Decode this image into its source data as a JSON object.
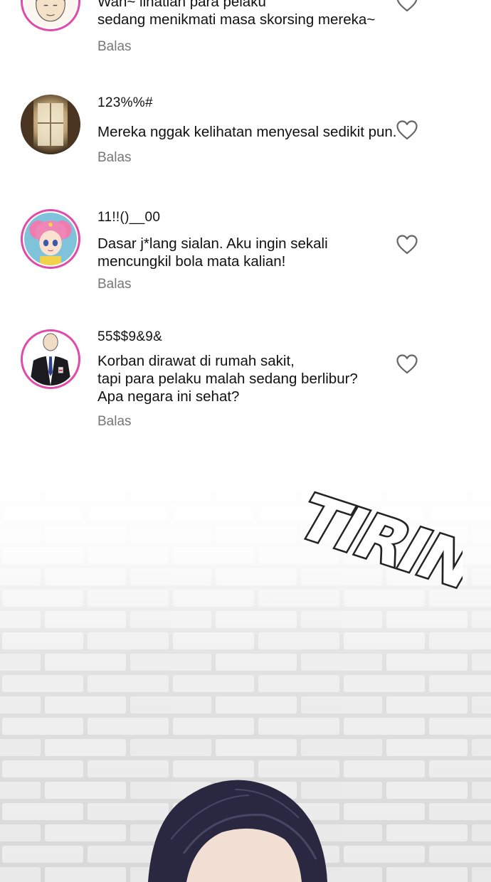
{
  "comments": [
    {
      "username": "",
      "text": "Wah~ lihatlah para pelaku\nsedang menikmati masa skorsing mereka~",
      "reply_label": "Balas",
      "avatar_icon": "cartoon-man-avatar-icon"
    },
    {
      "username": "123%%#",
      "text": "Mereka nggak kelihatan menyesal sedikit pun.",
      "reply_label": "Balas",
      "avatar_icon": "window-photo-avatar-icon"
    },
    {
      "username": "11!!()__00",
      "text": "Dasar j*lang sialan. Aku ingin sekali\nmencungkil bola mata kalian!",
      "reply_label": "Balas",
      "avatar_icon": "anime-girl-avatar-icon"
    },
    {
      "username": "55$$9&9&",
      "text": "Korban dirawat di rumah sakit,\ntapi para pelaku malah sedang berlibur?\nApa negara ini sehat?",
      "reply_label": "Balas",
      "avatar_icon": "suited-man-avatar-icon"
    }
  ],
  "sound_effect": "TIRING",
  "colors": {
    "ring": "#e04aa8",
    "reply_text": "#777777",
    "heart_outline": "#666666",
    "hair": "#2a2740"
  }
}
